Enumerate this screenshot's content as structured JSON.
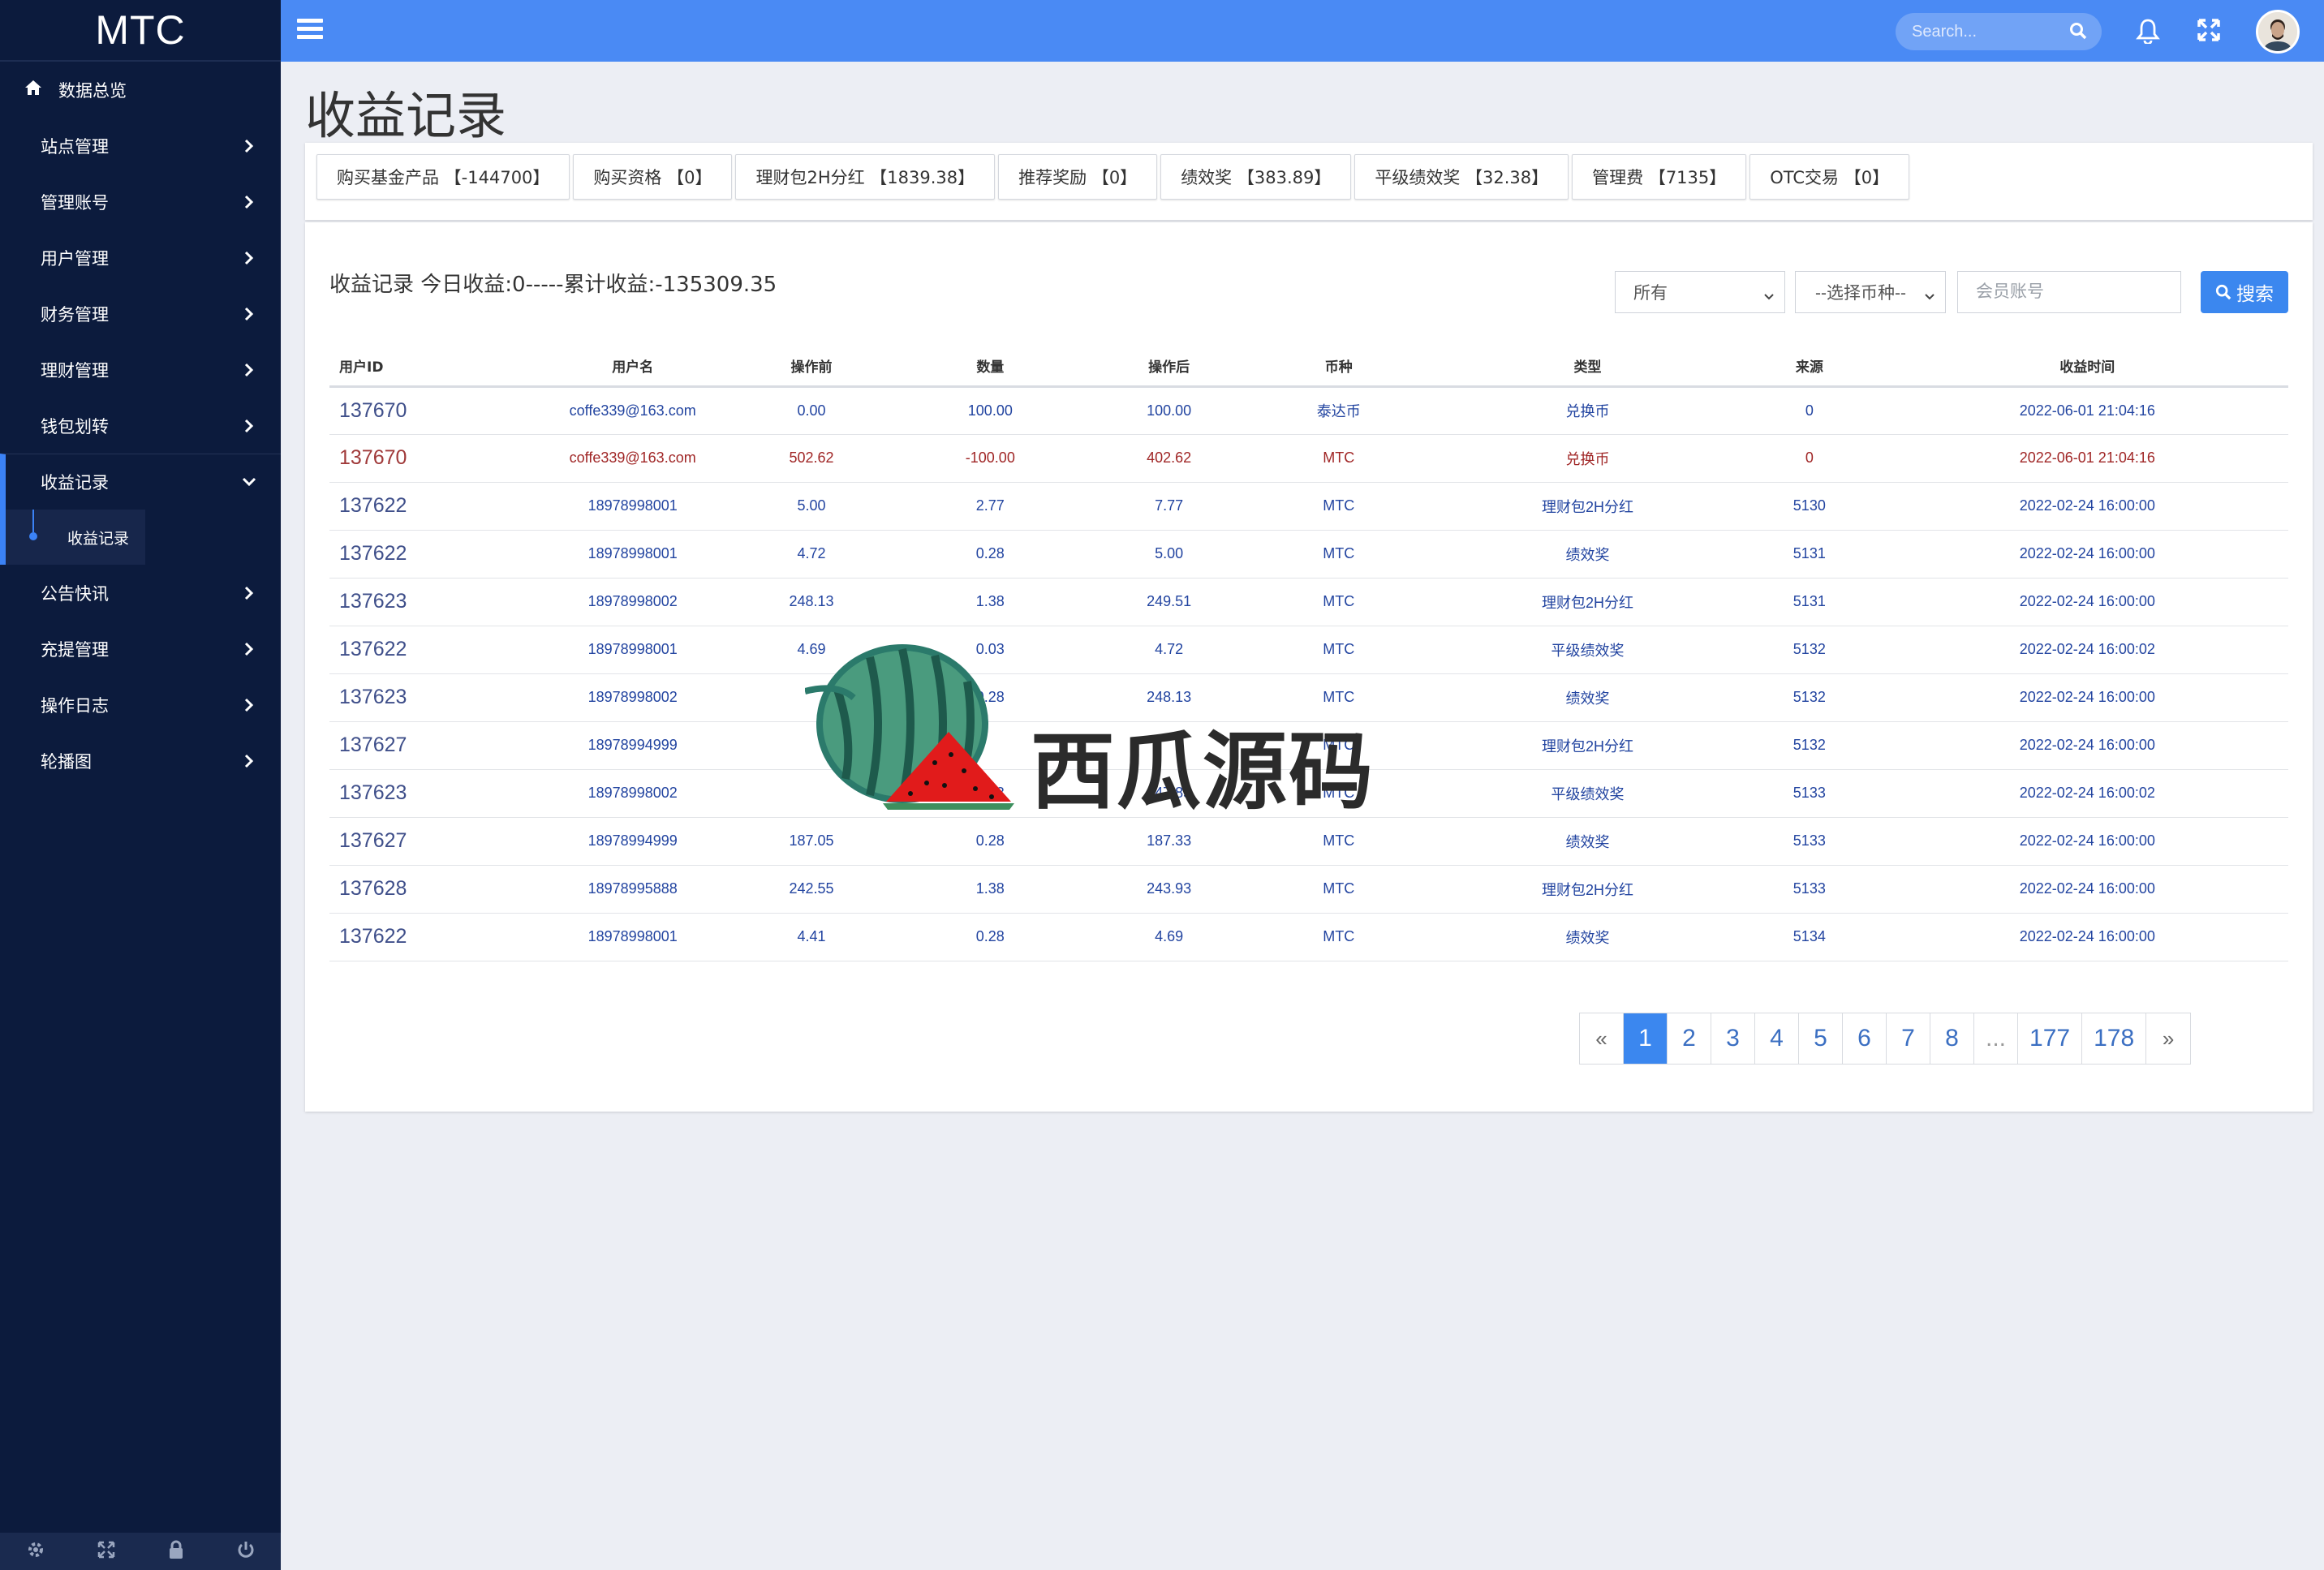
{
  "app": {
    "brand": "MTC"
  },
  "sidebar": {
    "home": "数据总览",
    "items": [
      {
        "label": "站点管理"
      },
      {
        "label": "管理账号"
      },
      {
        "label": "用户管理"
      },
      {
        "label": "财务管理"
      },
      {
        "label": "理财管理"
      },
      {
        "label": "钱包划转"
      }
    ],
    "active": {
      "label": "收益记录",
      "sub": "收益记录"
    },
    "items2": [
      {
        "label": "公告快讯"
      },
      {
        "label": "充提管理"
      },
      {
        "label": "操作日志"
      },
      {
        "label": "轮播图"
      }
    ]
  },
  "topbar": {
    "search_placeholder": "Search..."
  },
  "page": {
    "title": "收益记录"
  },
  "tabs": [
    "购买基金产品 【-144700】",
    "购买资格 【0】",
    "理财包2H分红 【1839.38】",
    "推荐奖励 【0】",
    "绩效奖 【383.89】",
    "平级绩效奖 【32.38】",
    "管理费 【7135】",
    "OTC交易 【0】"
  ],
  "summary": "收益记录 今日收益:0-----累计收益:-135309.35",
  "filters": {
    "scope": "所有",
    "currency": "--选择币种--",
    "account_placeholder": "会员账号",
    "search_label": "搜索"
  },
  "table": {
    "headers": [
      "用户ID",
      "用户名",
      "操作前",
      "数量",
      "操作后",
      "币种",
      "类型",
      "来源",
      "收益时间"
    ],
    "rows": [
      [
        "137670",
        "coffe339@163.com",
        "0.00",
        "100.00",
        "100.00",
        "泰达币",
        "兑换币",
        "0",
        "2022-06-01 21:04:16"
      ],
      [
        "137670",
        "coffe339@163.com",
        "502.62",
        "-100.00",
        "402.62",
        "MTC",
        "兑换币",
        "0",
        "2022-06-01 21:04:16"
      ],
      [
        "137622",
        "18978998001",
        "5.00",
        "2.77",
        "7.77",
        "MTC",
        "理财包2H分红",
        "5130",
        "2022-02-24 16:00:00"
      ],
      [
        "137622",
        "18978998001",
        "4.72",
        "0.28",
        "5.00",
        "MTC",
        "绩效奖",
        "5131",
        "2022-02-24 16:00:00"
      ],
      [
        "137623",
        "18978998002",
        "248.13",
        "1.38",
        "249.51",
        "MTC",
        "理财包2H分红",
        "5131",
        "2022-02-24 16:00:00"
      ],
      [
        "137622",
        "18978998001",
        "4.69",
        "0.03",
        "4.72",
        "MTC",
        "平级绩效奖",
        "5132",
        "2022-02-24 16:00:02"
      ],
      [
        "137623",
        "18978998002",
        "",
        "0.28",
        "248.13",
        "MTC",
        "绩效奖",
        "5132",
        "2022-02-24 16:00:00"
      ],
      [
        "137627",
        "18978994999",
        "",
        "",
        "",
        "MTC",
        "理财包2H分红",
        "5132",
        "2022-02-24 16:00:00"
      ],
      [
        "137623",
        "18978998002",
        "",
        "0.03",
        "247.85",
        "MTC",
        "平级绩效奖",
        "5133",
        "2022-02-24 16:00:02"
      ],
      [
        "137627",
        "18978994999",
        "187.05",
        "0.28",
        "187.33",
        "MTC",
        "绩效奖",
        "5133",
        "2022-02-24 16:00:00"
      ],
      [
        "137628",
        "18978995888",
        "242.55",
        "1.38",
        "243.93",
        "MTC",
        "理财包2H分红",
        "5133",
        "2022-02-24 16:00:00"
      ],
      [
        "137622",
        "18978998001",
        "4.41",
        "0.28",
        "4.69",
        "MTC",
        "绩效奖",
        "5134",
        "2022-02-24 16:00:00"
      ]
    ],
    "highlight_row": 1
  },
  "pagination": [
    "«",
    "1",
    "2",
    "3",
    "4",
    "5",
    "6",
    "7",
    "8",
    "...",
    "177",
    "178",
    "»"
  ],
  "pagination_active": "1",
  "watermark": "西瓜源码",
  "colors": {
    "topbar": "#4a8af4",
    "sidebar": "#0c1b3d",
    "accent": "#3b87ef"
  }
}
